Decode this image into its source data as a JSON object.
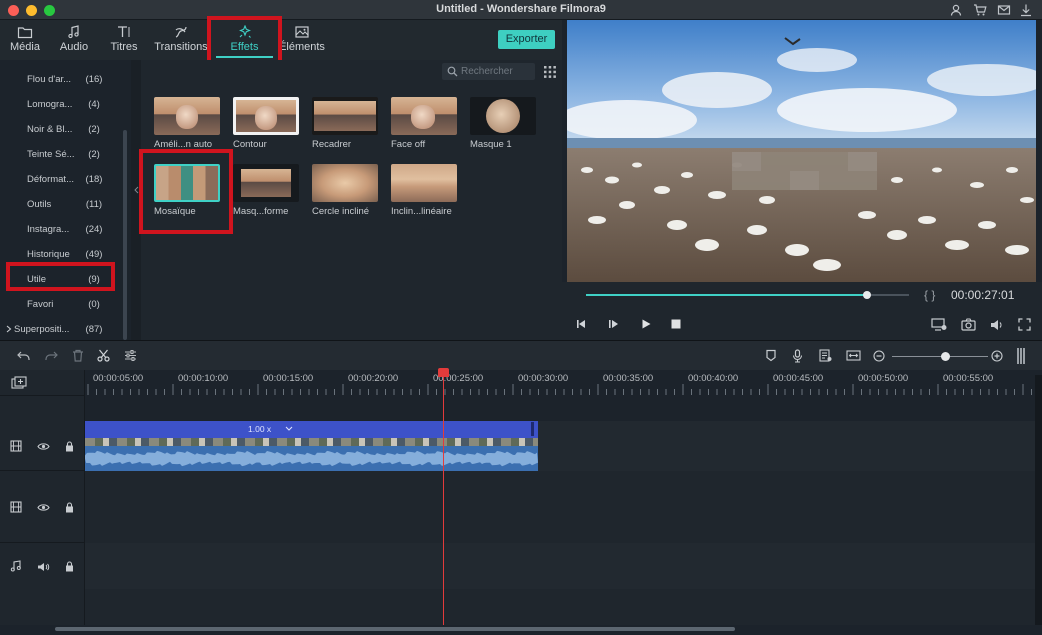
{
  "window": {
    "title": "Untitled - Wondershare Filmora9"
  },
  "tabs": [
    {
      "label": "Média",
      "icon": "folder-icon"
    },
    {
      "label": "Audio",
      "icon": "music-note-icon"
    },
    {
      "label": "Titres",
      "icon": "title-text-icon"
    },
    {
      "label": "Transitions",
      "icon": "transition-icon"
    },
    {
      "label": "Effets",
      "icon": "effects-sparkle-icon"
    },
    {
      "label": "Éléments",
      "icon": "image-icon"
    }
  ],
  "export_label": "Exporter",
  "search": {
    "placeholder": "Rechercher"
  },
  "categories": [
    {
      "name": "Flou d'ar...",
      "count": "(16)"
    },
    {
      "name": "Lomogra...",
      "count": "(4)"
    },
    {
      "name": "Noir & Bl...",
      "count": "(2)"
    },
    {
      "name": "Teinte Sé...",
      "count": "(2)"
    },
    {
      "name": "Déformat...",
      "count": "(18)"
    },
    {
      "name": "Outils",
      "count": "(11)"
    },
    {
      "name": "Instagra...",
      "count": "(24)"
    },
    {
      "name": "Historique",
      "count": "(49)"
    },
    {
      "name": "Utile",
      "count": "(9)"
    },
    {
      "name": "Favori",
      "count": "(0)"
    },
    {
      "name": "Superpositi...",
      "count": "(87)"
    }
  ],
  "effects": [
    {
      "label": "Améli...n auto"
    },
    {
      "label": "Contour"
    },
    {
      "label": "Recadrer"
    },
    {
      "label": "Face off"
    },
    {
      "label": "Masque 1"
    },
    {
      "label": "Mosaïque"
    },
    {
      "label": "Masq...forme"
    },
    {
      "label": "Cercle incliné"
    },
    {
      "label": "Inclin...linéaire"
    }
  ],
  "player": {
    "timecode": "00:00:27:01",
    "progress": 0.87
  },
  "ruler_ticks": [
    "00:00:05:00",
    "00:00:10:00",
    "00:00:15:00",
    "00:00:20:00",
    "00:00:25:00",
    "00:00:30:00",
    "00:00:35:00",
    "00:00:40:00",
    "00:00:45:00",
    "00:00:50:00",
    "00:00:55:00"
  ],
  "clip": {
    "speed_label": "1.00 x"
  },
  "zoom": {
    "level": 0.56
  },
  "colors": {
    "accent": "#3fd1c6",
    "highlight": "#d0141e",
    "playhead": "#e23b3b",
    "clip_video": "#3d52c9",
    "clip_audio": "#3b6fb0"
  }
}
